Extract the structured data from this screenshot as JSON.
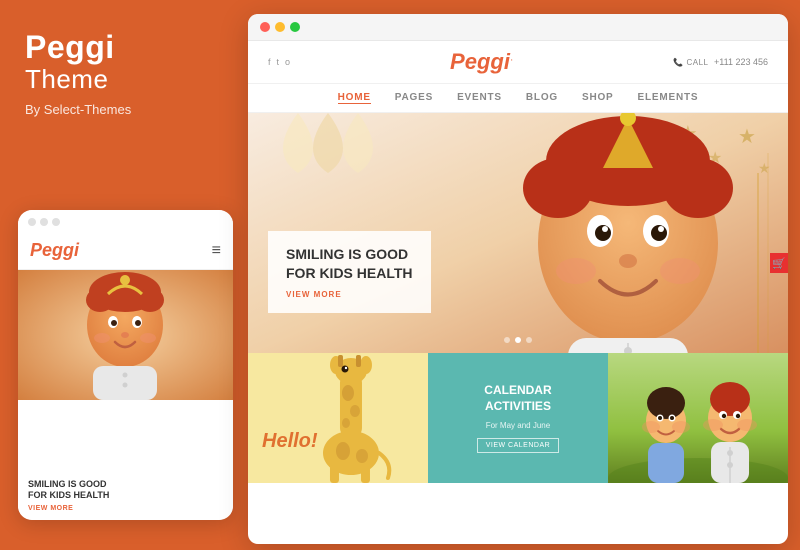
{
  "left": {
    "title": "Peggi",
    "subtitle": "Theme",
    "by": "By Select-Themes"
  },
  "mobile": {
    "logo": "Peggi",
    "menu_icon": "≡",
    "hero_title": "SMILING IS GOOD\nFOR KIDS HEALTH",
    "view_more": "VIEW MORE"
  },
  "desktop": {
    "call_label": "CALL",
    "call_number": "+111 223 456",
    "logo": "Peggi",
    "social": [
      "f",
      "t",
      "o"
    ],
    "nav": [
      "HOME",
      "PAGES",
      "EVENTS",
      "BLOG",
      "SHOP",
      "ELEMENTS"
    ],
    "hero": {
      "title": "SMILING IS GOOD\nFOR KIDS HEALTH",
      "view_more": "VIEW MORE"
    },
    "grid": {
      "hello": "Hello!",
      "calendar_title": "CALENDAR\nACTIVITIES",
      "calendar_sub": "For May and June",
      "calendar_btn": "VIEW CALENDAR"
    }
  }
}
